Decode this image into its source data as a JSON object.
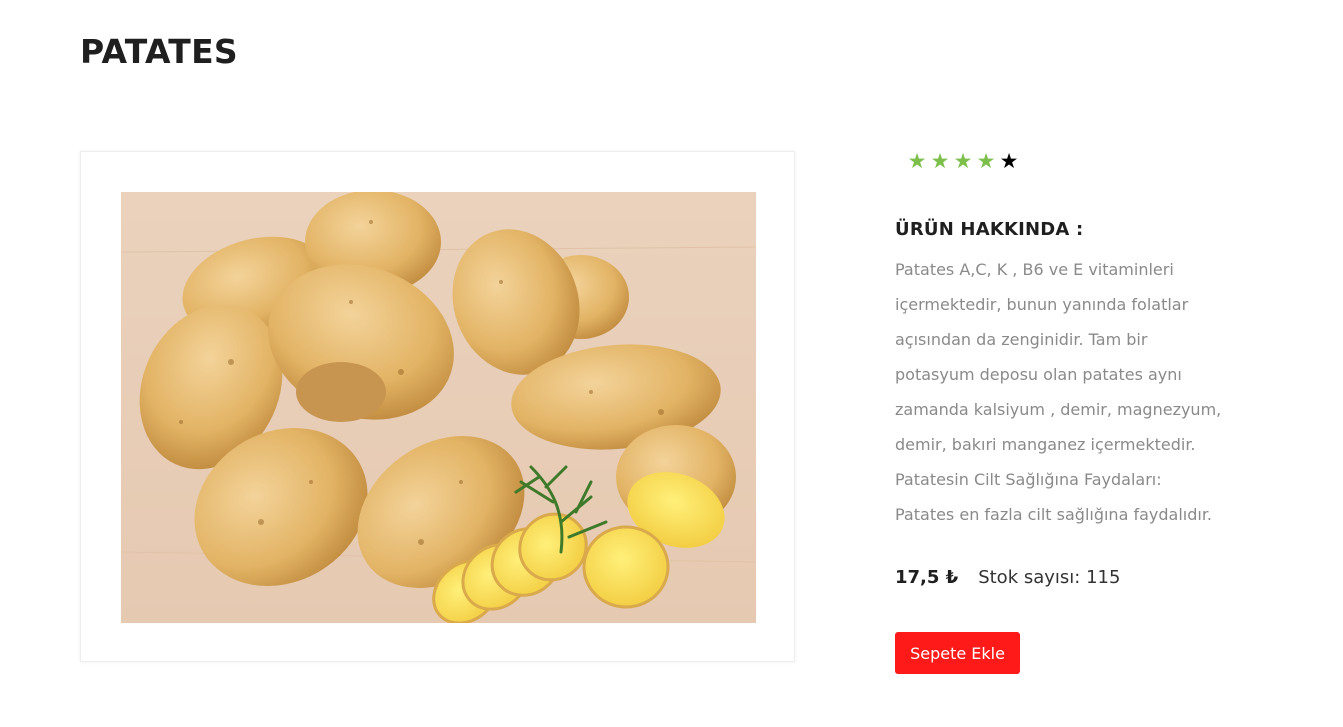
{
  "product": {
    "title": "PATATES",
    "rating": {
      "filled": 4,
      "total": 5,
      "filled_color": "#7cc04b",
      "empty_color": "#000000"
    },
    "about_heading": "ÜRÜN HAKKINDA :",
    "about_lines": [
      "Patates A,C, K , B6 ve E vitaminleri",
      "içermektedir, bunun yanında folatlar",
      "açısından da zenginidir. Tam bir",
      "potasyum deposu olan patates aynı",
      "zamanda kalsiyum , demir, magnezyum,",
      "demir, bakıri manganez içermektedir.",
      "Patatesin Cilt Sağlığına Faydaları:",
      "Patates en fazla cilt sağlığına faydalıdır."
    ],
    "price": "17,5 ₺",
    "stock": "Stok sayısı: 115",
    "add_to_cart_label": "Sepete Ekle",
    "accent_color": "#ff1a1a"
  }
}
